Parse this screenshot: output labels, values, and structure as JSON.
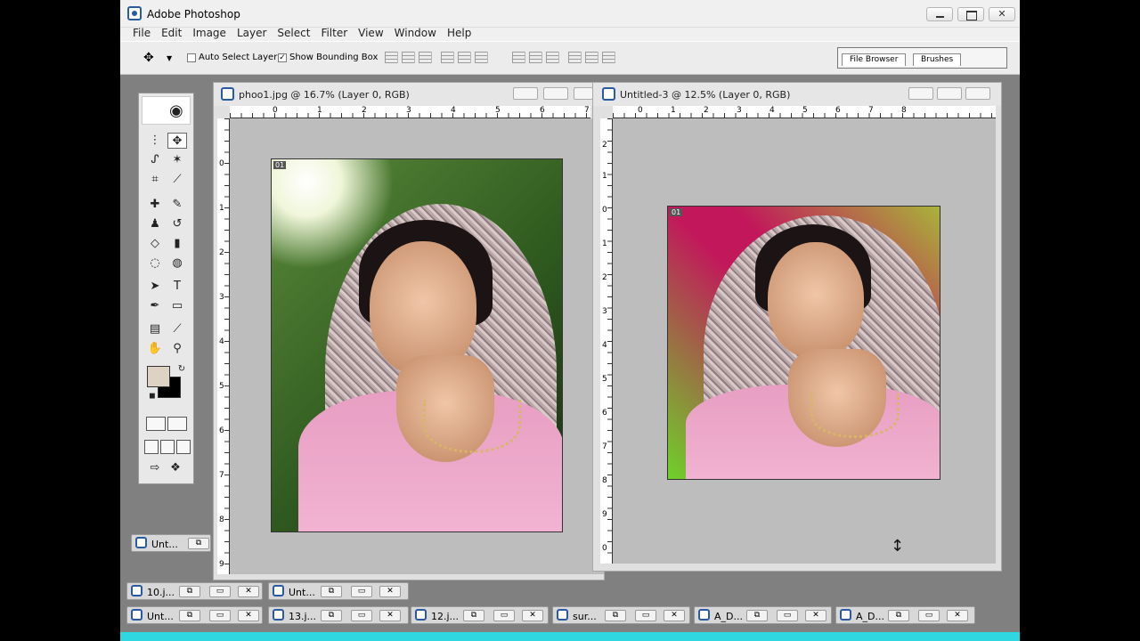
{
  "app": {
    "title": "Adobe Photoshop"
  },
  "menu": [
    "File",
    "Edit",
    "Image",
    "Layer",
    "Select",
    "Filter",
    "View",
    "Window",
    "Help"
  ],
  "options": {
    "auto_select_layer": "Auto Select Layer",
    "auto_select_checked": false,
    "show_bounding_box": "Show Bounding Box",
    "show_bounding_checked": true
  },
  "palette_well": {
    "tabs": [
      "File Browser",
      "Brushes"
    ]
  },
  "documents": [
    {
      "title": "phoo1.jpg @ 16.7% (Layer 0, RGB)",
      "ruler_h": [
        "0",
        "1",
        "2",
        "3",
        "4",
        "5",
        "6",
        "7"
      ],
      "ruler_v": [
        "0",
        "1",
        "2",
        "3",
        "4",
        "5",
        "6",
        "7",
        "8",
        "9"
      ],
      "tag": "01",
      "background": "#3b6b2a"
    },
    {
      "title": "Untitled-3 @ 12.5% (Layer 0, RGB)",
      "ruler_h": [
        "0",
        "1",
        "2",
        "3",
        "4",
        "5",
        "6",
        "7",
        "8"
      ],
      "ruler_v": [
        "2",
        "1",
        "0",
        "1",
        "2",
        "3",
        "4",
        "5",
        "6",
        "7",
        "8",
        "9",
        "0"
      ],
      "tag": "01",
      "background": "#c2185b"
    }
  ],
  "minimized_windows": [
    "Unt...",
    "10.j...",
    "Unt...",
    "Unt...",
    "13.j...",
    "12.j...",
    "sur...",
    "A_D...",
    "A_D..."
  ],
  "colors": {
    "foreground": "#ddd2c3",
    "background": "#000000",
    "accent": "#2fd7e0"
  }
}
